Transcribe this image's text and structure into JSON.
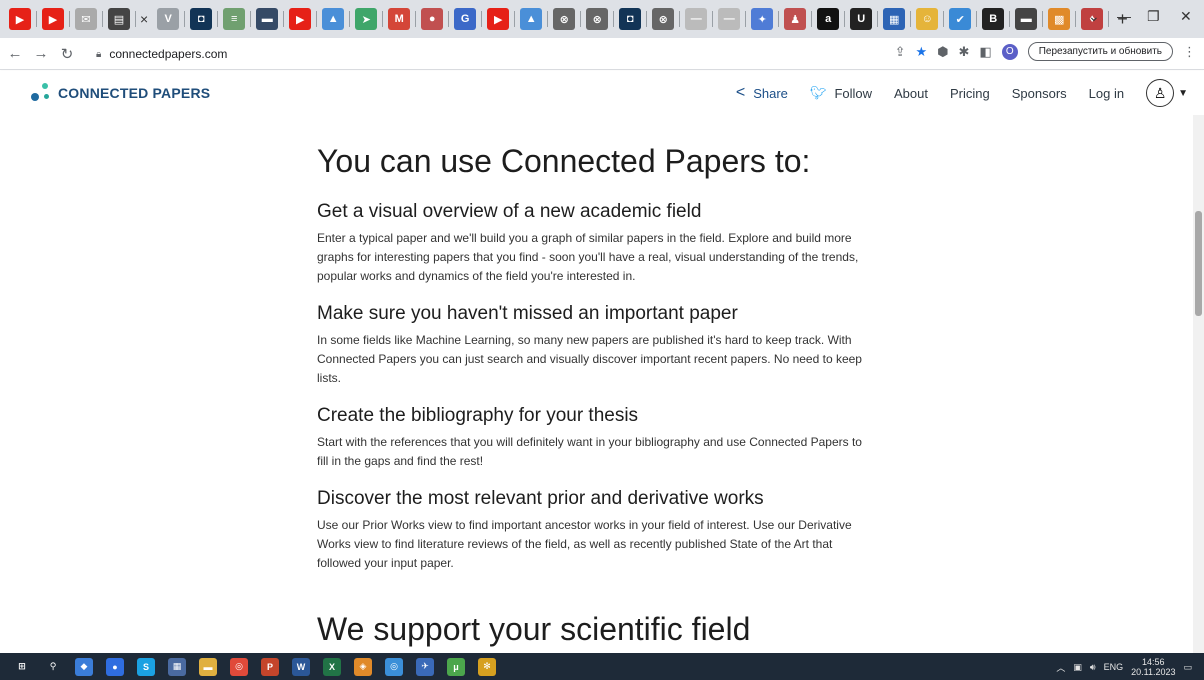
{
  "browser": {
    "tabs": [
      {
        "icon": "youtube-icon",
        "glyph": "▶",
        "color": "#e62117"
      },
      {
        "icon": "youtube-icon",
        "glyph": "▶",
        "color": "#e62117"
      },
      {
        "icon": "gmail-icon",
        "glyph": "✉",
        "color": "#aaaaaa"
      },
      {
        "icon": "book-icon",
        "glyph": "▤",
        "color": "#444444"
      },
      {
        "icon": "close-icon",
        "glyph": "×",
        "color": "#333333"
      },
      {
        "icon": "v-icon",
        "glyph": "V",
        "color": "#9aa0a6"
      },
      {
        "icon": "square-icon",
        "glyph": "◘",
        "color": "#123456"
      },
      {
        "icon": "image-icon",
        "glyph": "≡",
        "color": "#70a070"
      },
      {
        "icon": "print-icon",
        "glyph": "▬",
        "color": "#354a66"
      },
      {
        "icon": "youtube-icon",
        "glyph": "▶",
        "color": "#e62117"
      },
      {
        "icon": "graduation-icon",
        "glyph": "▲",
        "color": "#4a8fd8"
      },
      {
        "icon": "arrow-icon",
        "glyph": "➤",
        "color": "#3fa66a"
      },
      {
        "icon": "gmail-icon",
        "glyph": "M",
        "color": "#d44638"
      },
      {
        "icon": "circle-icon",
        "glyph": "●",
        "color": "#c15050"
      },
      {
        "icon": "g-icon",
        "glyph": "G",
        "color": "#3c69c8"
      },
      {
        "icon": "youtube-icon",
        "glyph": "▶",
        "color": "#e62117"
      },
      {
        "icon": "graduation-icon",
        "glyph": "▲",
        "color": "#4a8fd8"
      },
      {
        "icon": "circle-icon",
        "glyph": "⊗",
        "color": "#666666"
      },
      {
        "icon": "circle-icon",
        "glyph": "⊗",
        "color": "#666666"
      },
      {
        "icon": "square-icon",
        "glyph": "◘",
        "color": "#123456"
      },
      {
        "icon": "circle-icon",
        "glyph": "⊗",
        "color": "#666666"
      },
      {
        "icon": "doc-icon",
        "glyph": "—",
        "color": "#bbbbbb"
      },
      {
        "icon": "doc-icon",
        "glyph": "—",
        "color": "#bbbbbb"
      },
      {
        "icon": "sparkle-icon",
        "glyph": "✦",
        "color": "#4f7cd6"
      },
      {
        "icon": "person-icon",
        "glyph": "♟",
        "color": "#c05050"
      },
      {
        "icon": "amazon-icon",
        "glyph": "a",
        "color": "#111111"
      },
      {
        "icon": "u-icon",
        "glyph": "U",
        "color": "#222222"
      },
      {
        "icon": "chart-icon",
        "glyph": "▦",
        "color": "#2d64b5"
      },
      {
        "icon": "smile-icon",
        "glyph": "☺",
        "color": "#e5b43a"
      },
      {
        "icon": "check-icon",
        "glyph": "✔",
        "color": "#3a8ad6"
      },
      {
        "icon": "b-icon",
        "glyph": "B",
        "color": "#222222"
      },
      {
        "icon": "print-icon",
        "glyph": "▬",
        "color": "#444444"
      },
      {
        "icon": "image-icon",
        "glyph": "▩",
        "color": "#e08a2a"
      },
      {
        "icon": "shield-icon",
        "glyph": "♦",
        "color": "#c04040"
      }
    ],
    "address": "connectedpapers.com",
    "profile_initial": "O",
    "restart_label": "Перезапустить и обновить"
  },
  "site": {
    "brand": "CONNECTED PAPERS",
    "nav": [
      {
        "label": "Share",
        "icon": "share-icon"
      },
      {
        "label": "Follow",
        "icon": "twitter-icon"
      },
      {
        "label": "About"
      },
      {
        "label": "Pricing"
      },
      {
        "label": "Sponsors"
      },
      {
        "label": "Log in"
      }
    ]
  },
  "main": {
    "heading": "You can use Connected Papers to:",
    "sections": [
      {
        "title": "Get a visual overview of a new academic field",
        "lines": [
          "Enter a typical paper and we'll build you a graph of similar papers in the field. Explore and build more",
          "graphs for interesting papers that you find - soon you'll have a real, visual understanding of the trends,",
          "popular works and dynamics of the field you're interested in."
        ]
      },
      {
        "title": "Make sure you haven't missed an important paper",
        "lines": [
          "In some fields like Machine Learning, so many new papers are published it's hard to keep track. With",
          "Connected Papers you can just search and visually discover important recent papers. No need to keep",
          "lists."
        ]
      },
      {
        "title": "Create the bibliography for your thesis",
        "lines": [
          "Start with the references that you will definitely want in your bibliography and use Connected Papers to",
          "fill in the gaps and find the rest!"
        ]
      },
      {
        "title": "Discover the most relevant prior and derivative works",
        "lines": [
          "Use our Prior Works view to find important ancestor works in your field of interest. Use our Derivative",
          "Works view to find literature reviews of the field, as well as recently published State of the Art that",
          "followed your input paper."
        ]
      }
    ],
    "next_heading": "We support your scientific field"
  },
  "taskbar": {
    "apps": [
      {
        "icon": "windows-start-icon",
        "glyph": "⊞",
        "color": "#1e2a38"
      },
      {
        "icon": "search-icon",
        "glyph": "⚲",
        "color": "#1e2a38"
      },
      {
        "icon": "app-icon",
        "glyph": "◆",
        "color": "#3b7dd8"
      },
      {
        "icon": "app-icon",
        "glyph": "●",
        "color": "#2f6de0"
      },
      {
        "icon": "skype-icon",
        "glyph": "S",
        "color": "#1ba1e2"
      },
      {
        "icon": "calculator-icon",
        "glyph": "▦",
        "color": "#4a6aa0"
      },
      {
        "icon": "folder-icon",
        "glyph": "▬",
        "color": "#e0b040"
      },
      {
        "icon": "chrome-icon",
        "glyph": "◎",
        "color": "#e04a3a"
      },
      {
        "icon": "powerpoint-icon",
        "glyph": "P",
        "color": "#c4452b"
      },
      {
        "icon": "word-icon",
        "glyph": "W",
        "color": "#2b5797"
      },
      {
        "icon": "excel-icon",
        "glyph": "X",
        "color": "#217346"
      },
      {
        "icon": "app-icon",
        "glyph": "◈",
        "color": "#e08a2a"
      },
      {
        "icon": "chrome-icon",
        "glyph": "◎",
        "color": "#3b8fd8"
      },
      {
        "icon": "app-icon",
        "glyph": "✈",
        "color": "#3a6ab8"
      },
      {
        "icon": "utorrent-icon",
        "glyph": "μ",
        "color": "#4ca64c"
      },
      {
        "icon": "gear-icon",
        "glyph": "✻",
        "color": "#d6a020"
      }
    ],
    "lang": "ENG",
    "time": "14:56",
    "date": "20.11.2023"
  }
}
